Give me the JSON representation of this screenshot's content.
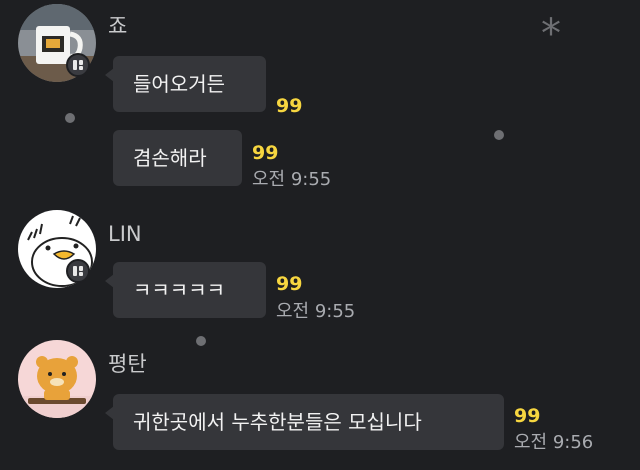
{
  "messages": [
    {
      "sender": "죠",
      "bubbles": [
        {
          "text": "들어오거든",
          "unread": "99",
          "time": ""
        },
        {
          "text": "겸손해라",
          "unread": "99",
          "time": "오전 9:55"
        }
      ]
    },
    {
      "sender": "LIN",
      "bubbles": [
        {
          "text": "ㅋㅋㅋㅋㅋ",
          "unread": "99",
          "time": "오전 9:55"
        }
      ]
    },
    {
      "sender": "평탄",
      "bubbles": [
        {
          "text": "귀한곳에서 누추한분들은 모십니다",
          "unread": "99",
          "time": "오전 9:56"
        }
      ]
    }
  ],
  "colors": {
    "background": "#1e1f22",
    "bubble": "#35363a",
    "unread": "#f7d640",
    "time": "#a9abb0"
  },
  "icons": [
    "mug-photo-avatar",
    "duck-avatar",
    "lion-avatar",
    "pc-badge-icon",
    "asterisk-icon"
  ]
}
